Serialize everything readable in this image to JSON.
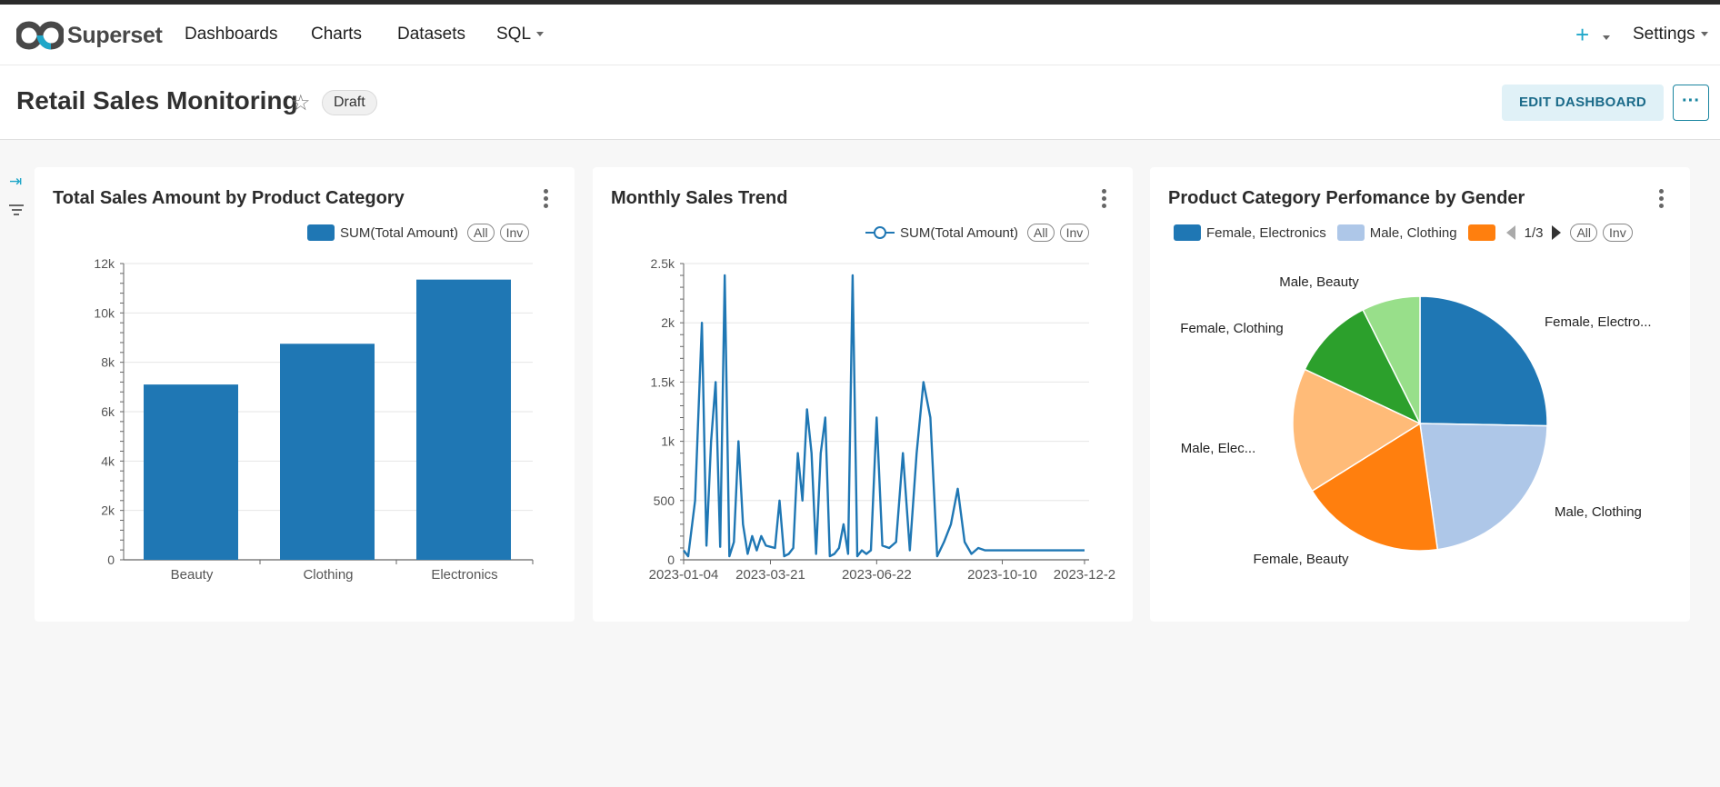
{
  "app": {
    "name": "Superset"
  },
  "nav": {
    "items": [
      "Dashboards",
      "Charts",
      "Datasets",
      "SQL"
    ],
    "plus": "+",
    "settings": "Settings"
  },
  "dashboard": {
    "title": "Retail Sales Monitoring",
    "status": "Draft",
    "edit_label": "EDIT DASHBOARD",
    "more_label": "···"
  },
  "colors": {
    "accent": "#20a7c9",
    "series_blue": "#1f77b4",
    "light_blue": "#aec7e8",
    "orange": "#ff7f0e",
    "light_orange": "#ffbb78",
    "green": "#2ca02c",
    "light_green": "#98df8a"
  },
  "icons": [
    "logo-icon",
    "star-icon",
    "chevron-down-icon",
    "kebab-icon",
    "expand-icon",
    "filter-icon",
    "arrow-left-icon",
    "arrow-right-icon"
  ],
  "legend_controls": {
    "all": "All",
    "inv": "Inv"
  },
  "pie_pagination": "1/3",
  "chart_data": [
    {
      "type": "bar",
      "title": "Total Sales Amount by Product Category",
      "series_name": "SUM(Total Amount)",
      "categories": [
        "Beauty",
        "Clothing",
        "Electronics"
      ],
      "values": [
        7100,
        8750,
        11350
      ],
      "ylim": [
        0,
        12000
      ],
      "yticks": [
        0,
        2000,
        4000,
        6000,
        8000,
        10000,
        12000
      ],
      "ytick_labels": [
        "0",
        "2k",
        "4k",
        "6k",
        "8k",
        "10k",
        "12k"
      ],
      "legend_position": "top-right",
      "grid": true
    },
    {
      "type": "line",
      "title": "Monthly Sales Trend",
      "series_name": "SUM(Total Amount)",
      "x": [
        "2023-01-04",
        "2023-01-08",
        "2023-01-14",
        "2023-01-20",
        "2023-01-24",
        "2023-01-28",
        "2023-02-01",
        "2023-02-05",
        "2023-02-09",
        "2023-02-13",
        "2023-02-17",
        "2023-02-21",
        "2023-02-25",
        "2023-03-01",
        "2023-03-05",
        "2023-03-09",
        "2023-03-13",
        "2023-03-17",
        "2023-03-21",
        "2023-03-25",
        "2023-03-29",
        "2023-04-02",
        "2023-04-06",
        "2023-04-10",
        "2023-04-14",
        "2023-04-18",
        "2023-04-22",
        "2023-04-26",
        "2023-04-30",
        "2023-05-04",
        "2023-05-08",
        "2023-05-12",
        "2023-05-16",
        "2023-05-20",
        "2023-05-24",
        "2023-05-28",
        "2023-06-01",
        "2023-06-05",
        "2023-06-09",
        "2023-06-13",
        "2023-06-17",
        "2023-06-22",
        "2023-06-27",
        "2023-07-03",
        "2023-07-09",
        "2023-07-15",
        "2023-07-21",
        "2023-07-27",
        "2023-08-02",
        "2023-08-08",
        "2023-08-14",
        "2023-08-20",
        "2023-08-26",
        "2023-09-01",
        "2023-09-07",
        "2023-09-13",
        "2023-09-19",
        "2023-09-25",
        "2023-10-01",
        "2023-10-05",
        "2023-10-10",
        "2023-10-16",
        "2023-10-22",
        "2023-10-28",
        "2023-11-03",
        "2023-11-09",
        "2023-11-15",
        "2023-11-21",
        "2023-11-27",
        "2023-12-03",
        "2023-12-09",
        "2023-12-15",
        "2023-12-21"
      ],
      "values": [
        80,
        30,
        500,
        2000,
        120,
        1000,
        1500,
        110,
        2400,
        30,
        150,
        1000,
        300,
        50,
        200,
        80,
        200,
        120,
        110,
        100,
        500,
        30,
        50,
        100,
        900,
        500,
        1270,
        900,
        50,
        900,
        1200,
        30,
        50,
        100,
        300,
        50,
        2400,
        30,
        80,
        50,
        80,
        1200,
        120,
        100,
        150,
        900,
        80,
        900,
        1500,
        1200,
        30,
        150,
        300,
        600,
        150,
        50,
        100,
        80,
        80,
        80,
        80,
        80,
        80,
        80,
        80,
        80,
        80,
        80,
        80,
        80,
        80,
        80,
        80
      ],
      "ylim": [
        0,
        2500
      ],
      "yticks": [
        0,
        500,
        1000,
        1500,
        2000,
        2500
      ],
      "ytick_labels": [
        "0",
        "500",
        "1k",
        "1.5k",
        "2k",
        "2.5k"
      ],
      "xtick_labels": [
        "2023-01-04",
        "2023-03-21",
        "2023-06-22",
        "2023-10-10",
        "2023-12-2"
      ],
      "legend_position": "top-right",
      "grid": true
    },
    {
      "type": "pie",
      "title": "Product Category Perfomance by Gender",
      "slices": [
        {
          "label": "Female, Electronics",
          "short_label": "Female, Electro...",
          "value": 25.3,
          "color": "#1f77b4"
        },
        {
          "label": "Male, Clothing",
          "short_label": "Male, Clothing",
          "value": 22.5,
          "color": "#aec7e8"
        },
        {
          "label": "Female, Beauty",
          "short_label": "Female, Beauty",
          "value": 18.3,
          "color": "#ff7f0e"
        },
        {
          "label": "Male, Electronics",
          "short_label": "Male, Elec...",
          "value": 15.9,
          "color": "#ffbb78"
        },
        {
          "label": "Female, Clothing",
          "short_label": "Female, Clothing",
          "value": 10.6,
          "color": "#2ca02c"
        },
        {
          "label": "Male, Beauty",
          "short_label": "Male, Beauty",
          "value": 7.4,
          "color": "#98df8a"
        }
      ],
      "legend_visible": [
        "Female, Electronics",
        "Male, Clothing"
      ],
      "legend_position": "top",
      "grid": false
    }
  ]
}
